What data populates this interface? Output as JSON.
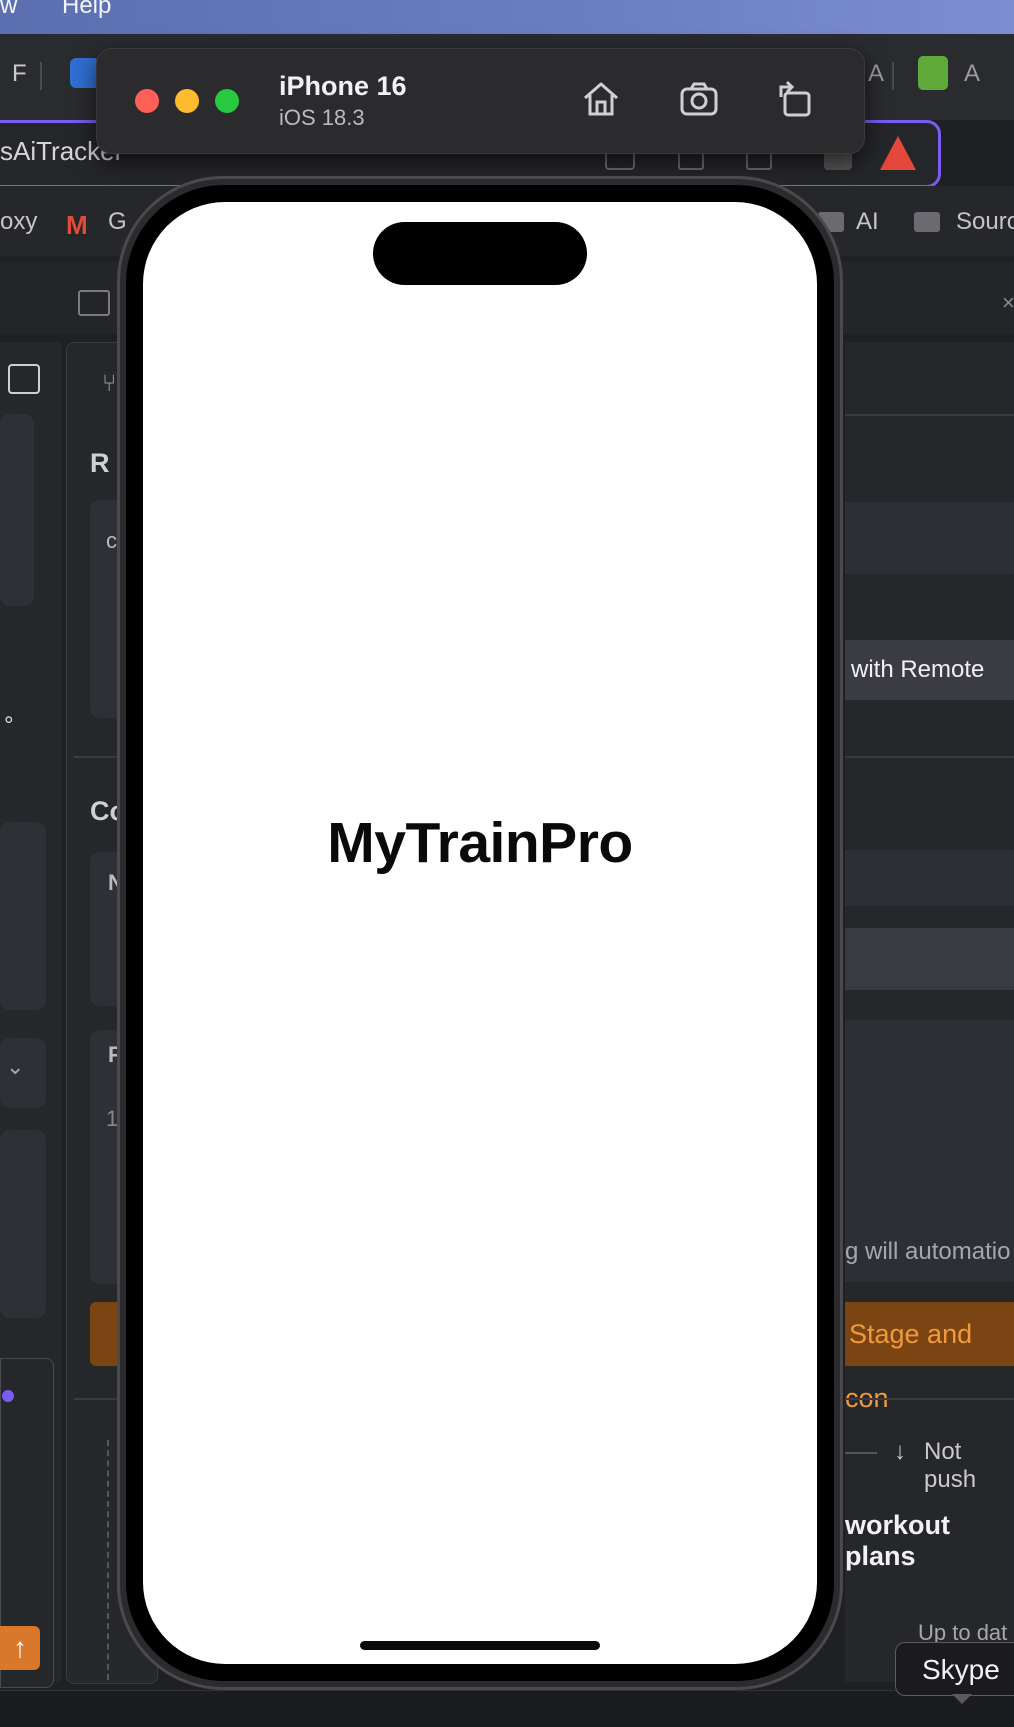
{
  "menubar": {
    "items": [
      "w",
      "Help"
    ]
  },
  "browser": {
    "tab_letters": [
      "F",
      "A",
      "A"
    ],
    "address_text": "sAiTracker",
    "bookmarks": [
      "oxy",
      "G",
      "AI",
      "Sourc"
    ]
  },
  "ide": {
    "left_section_letters": [
      "R",
      "c",
      "Co",
      "N",
      "F",
      "1"
    ],
    "remote_button_label": "with Remote",
    "hint_text": "g will automatio",
    "stage_button_label": "Stage and con",
    "not_pushed_label": "Not push",
    "commit_message": "workout plans",
    "up_to_date_label": "Up to dat",
    "degree_text": "°"
  },
  "simulator": {
    "device_name": "iPhone 16",
    "os_version": "iOS 18.3",
    "traffic_light_colors": [
      "#fe5f57",
      "#febc2e",
      "#28c840"
    ],
    "toolbar_icons": [
      "home-icon",
      "screenshot-icon",
      "rotate-icon"
    ]
  },
  "app": {
    "title": "MyTrainPro",
    "background": "#ffffff"
  },
  "tooltip": {
    "text": "Skype"
  }
}
